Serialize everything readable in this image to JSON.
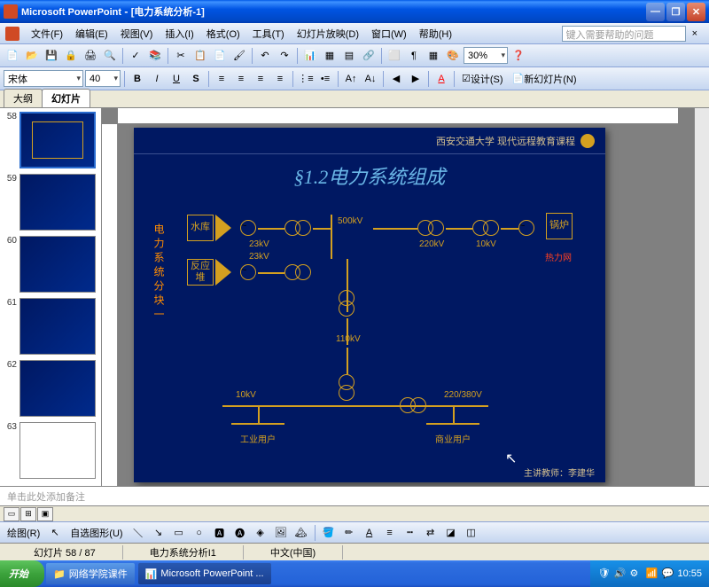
{
  "titlebar": {
    "app": "Microsoft PowerPoint",
    "doc": "[电力系统分析-1]"
  },
  "menu": {
    "file": "文件(F)",
    "edit": "编辑(E)",
    "view": "视图(V)",
    "insert": "插入(I)",
    "format": "格式(O)",
    "tools": "工具(T)",
    "slideshow": "幻灯片放映(D)",
    "window": "窗口(W)",
    "help": "帮助(H)",
    "helpbox": "键入需要帮助的问题"
  },
  "toolbar": {
    "zoom": "30%",
    "font": "宋体",
    "size": "40",
    "design": "设计(S)",
    "newslide": "新幻灯片(N)"
  },
  "tabs": {
    "outline": "大纲",
    "slides": "幻灯片"
  },
  "thumbs": [
    {
      "n": "58"
    },
    {
      "n": "59"
    },
    {
      "n": "60"
    },
    {
      "n": "61"
    },
    {
      "n": "62"
    },
    {
      "n": "63"
    }
  ],
  "slide": {
    "org": "西安交通大学 现代远程教育课程",
    "title": "§1.2电力系统组成",
    "sidebar": "电力系统分块一",
    "teacher": "主讲教师：李建华",
    "boxes": {
      "reservoir": "水库",
      "reactor": "反应堆",
      "boiler": "锅炉",
      "heat": "热力网",
      "ind": "工业用户",
      "com": "商业用户"
    },
    "labels": {
      "v500": "500kV",
      "v220": "220kV",
      "v110": "110kV",
      "v23a": "23kV",
      "v23b": "23kV",
      "v10a": "10kV",
      "v10b": "10kV",
      "v220380": "220/380V"
    }
  },
  "notes": {
    "placeholder": "单击此处添加备注"
  },
  "draw": {
    "label": "绘图(R)",
    "autoshape": "自选图形(U)"
  },
  "status": {
    "slide": "幻灯片 58 / 87",
    "design": "电力系统分析I1",
    "lang": "中文(中国)"
  },
  "taskbar": {
    "start": "开始",
    "task1": "网络学院课件",
    "task2": "Microsoft PowerPoint ...",
    "time": "10:55"
  }
}
